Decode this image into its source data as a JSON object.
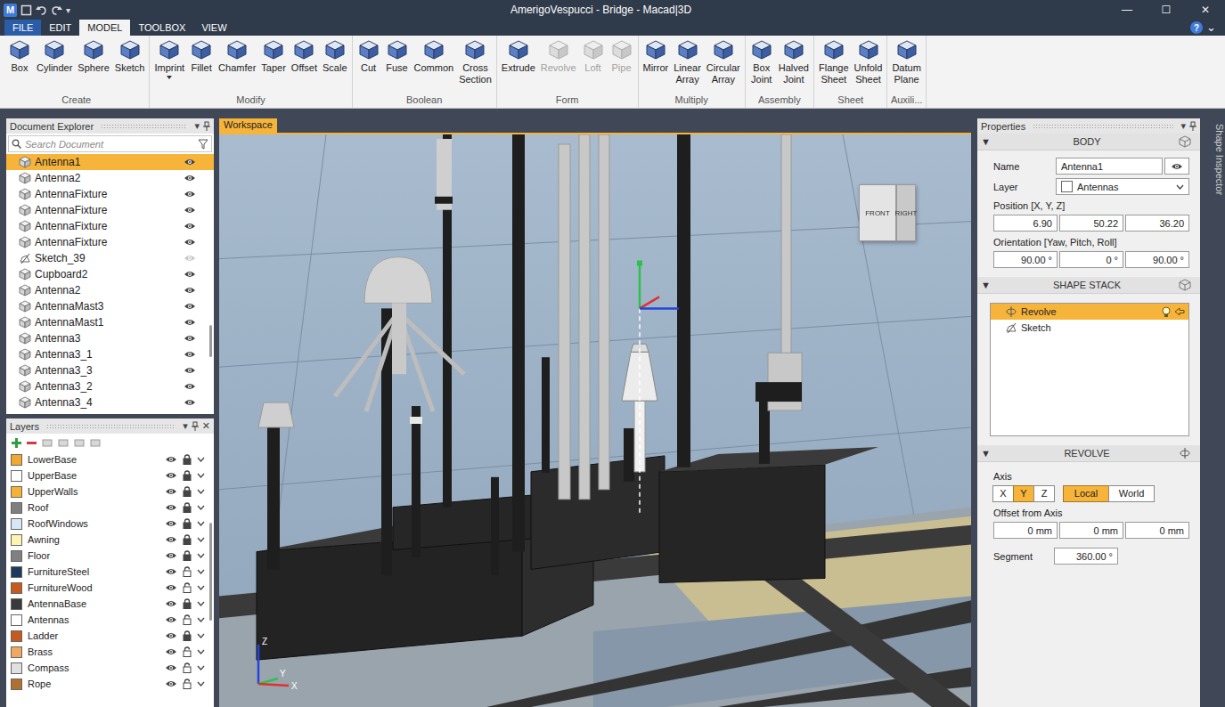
{
  "window": {
    "title": "AmerigoVespucci - Bridge - Macad|3D",
    "logo": "M",
    "quick_menu": "▾",
    "controls": [
      "—",
      "☐",
      "✕"
    ]
  },
  "menu": {
    "tabs": [
      {
        "label": "FILE",
        "kind": "file",
        "selected": false
      },
      {
        "label": "EDIT",
        "kind": "tab",
        "selected": false
      },
      {
        "label": "MODEL",
        "kind": "tab",
        "selected": true
      },
      {
        "label": "TOOLBOX",
        "kind": "tab",
        "selected": false
      },
      {
        "label": "VIEW",
        "kind": "tab",
        "selected": false
      }
    ],
    "help": "?",
    "collapse": "⌄"
  },
  "ribbon": {
    "groups": [
      {
        "label": "Create",
        "tools": [
          {
            "label": "Box",
            "disabled": false,
            "dropdown": false
          },
          {
            "label": "Cylinder",
            "disabled": false,
            "dropdown": false
          },
          {
            "label": "Sphere",
            "disabled": false,
            "dropdown": false
          },
          {
            "label": "Sketch",
            "disabled": false,
            "dropdown": false
          }
        ]
      },
      {
        "label": "Modify",
        "tools": [
          {
            "label": "Imprint",
            "disabled": false,
            "dropdown": true
          },
          {
            "label": "Fillet",
            "disabled": false,
            "dropdown": false
          },
          {
            "label": "Chamfer",
            "disabled": false,
            "dropdown": false
          },
          {
            "label": "Taper",
            "disabled": false,
            "dropdown": false
          },
          {
            "label": "Offset",
            "disabled": false,
            "dropdown": false
          },
          {
            "label": "Scale",
            "disabled": false,
            "dropdown": false
          }
        ]
      },
      {
        "label": "Boolean",
        "tools": [
          {
            "label": "Cut",
            "disabled": false,
            "dropdown": false
          },
          {
            "label": "Fuse",
            "disabled": false,
            "dropdown": false
          },
          {
            "label": "Common",
            "disabled": false,
            "dropdown": false
          },
          {
            "label": "Cross Section",
            "disabled": false,
            "dropdown": false
          }
        ]
      },
      {
        "label": "Form",
        "tools": [
          {
            "label": "Extrude",
            "disabled": false,
            "dropdown": false
          },
          {
            "label": "Revolve",
            "disabled": true,
            "dropdown": false
          },
          {
            "label": "Loft",
            "disabled": true,
            "dropdown": false
          },
          {
            "label": "Pipe",
            "disabled": true,
            "dropdown": false
          }
        ]
      },
      {
        "label": "Multiply",
        "tools": [
          {
            "label": "Mirror",
            "disabled": false,
            "dropdown": false
          },
          {
            "label": "Linear Array",
            "disabled": false,
            "dropdown": false
          },
          {
            "label": "Circular Array",
            "disabled": false,
            "dropdown": false
          }
        ]
      },
      {
        "label": "Assembly",
        "tools": [
          {
            "label": "Box Joint",
            "disabled": false,
            "dropdown": false
          },
          {
            "label": "Halved Joint",
            "disabled": false,
            "dropdown": false
          }
        ]
      },
      {
        "label": "Sheet",
        "tools": [
          {
            "label": "Flange Sheet",
            "disabled": false,
            "dropdown": false
          },
          {
            "label": "Unfold Sheet",
            "disabled": false,
            "dropdown": false
          }
        ]
      },
      {
        "label": "Auxili...",
        "tools": [
          {
            "label": "Datum Plane",
            "disabled": false,
            "dropdown": false
          }
        ]
      }
    ]
  },
  "explorer": {
    "title": "Document Explorer",
    "menu": "▾",
    "search_placeholder": "Search Document",
    "items": [
      {
        "name": "Antenna1",
        "kind": "body",
        "visible": true,
        "selected": true
      },
      {
        "name": "Antenna2",
        "kind": "body",
        "visible": true,
        "selected": false
      },
      {
        "name": "AntennaFixture",
        "kind": "body",
        "visible": true,
        "selected": false
      },
      {
        "name": "AntennaFixture",
        "kind": "body",
        "visible": true,
        "selected": false
      },
      {
        "name": "AntennaFixture",
        "kind": "body",
        "visible": true,
        "selected": false
      },
      {
        "name": "AntennaFixture",
        "kind": "body",
        "visible": true,
        "selected": false
      },
      {
        "name": "Sketch_39",
        "kind": "sketch",
        "visible": false,
        "selected": false
      },
      {
        "name": "Cupboard2",
        "kind": "body",
        "visible": true,
        "selected": false
      },
      {
        "name": "Antenna2",
        "kind": "body",
        "visible": true,
        "selected": false
      },
      {
        "name": "AntennaMast3",
        "kind": "body",
        "visible": true,
        "selected": false
      },
      {
        "name": "AntennaMast1",
        "kind": "body",
        "visible": true,
        "selected": false
      },
      {
        "name": "Antenna3",
        "kind": "body",
        "visible": true,
        "selected": false
      },
      {
        "name": "Antenna3_1",
        "kind": "body",
        "visible": true,
        "selected": false
      },
      {
        "name": "Antenna3_3",
        "kind": "body",
        "visible": true,
        "selected": false
      },
      {
        "name": "Antenna3_2",
        "kind": "body",
        "visible": true,
        "selected": false
      },
      {
        "name": "Antenna3_4",
        "kind": "body",
        "visible": true,
        "selected": false
      }
    ]
  },
  "layers": {
    "title": "Layers",
    "menu": "▾",
    "close": "✕",
    "items": [
      {
        "name": "LowerBase",
        "color": "#f0a830",
        "visible": true,
        "locked": true
      },
      {
        "name": "UpperBase",
        "color": "#ffffff",
        "visible": true,
        "locked": true
      },
      {
        "name": "UpperWalls",
        "color": "#f5b335",
        "visible": true,
        "locked": true
      },
      {
        "name": "Roof",
        "color": "#7f7f7f",
        "visible": true,
        "locked": true
      },
      {
        "name": "RoofWindows",
        "color": "#d6e8f5",
        "visible": true,
        "locked": true
      },
      {
        "name": "Awning",
        "color": "#fff3b0",
        "visible": true,
        "locked": true
      },
      {
        "name": "Floor",
        "color": "#808080",
        "visible": true,
        "locked": true
      },
      {
        "name": "FurnitureSteel",
        "color": "#1f3a5f",
        "visible": true,
        "locked": false
      },
      {
        "name": "FurnitureWood",
        "color": "#c65a1e",
        "visible": true,
        "locked": false
      },
      {
        "name": "AntennaBase",
        "color": "#3a3a3a",
        "visible": true,
        "locked": true
      },
      {
        "name": "Antennas",
        "color": "#ffffff",
        "visible": true,
        "locked": false
      },
      {
        "name": "Ladder",
        "color": "#c65a1e",
        "visible": true,
        "locked": true
      },
      {
        "name": "Brass",
        "color": "#f0a860",
        "visible": true,
        "locked": false
      },
      {
        "name": "Compass",
        "color": "#e0e0e0",
        "visible": true,
        "locked": false
      },
      {
        "name": "Rope",
        "color": "#b07030",
        "visible": true,
        "locked": false
      }
    ]
  },
  "workspace": {
    "tab": "Workspace",
    "viewcube": {
      "front": "FRONT",
      "right": "RIGHT"
    },
    "axes": {
      "z": "Z",
      "y": "Y",
      "x": "X"
    }
  },
  "properties": {
    "title": "Properties",
    "menu": "▾",
    "side_tab": "Shape Inspector",
    "body": {
      "title": "BODY",
      "collapse": "▼",
      "name_label": "Name",
      "name": "Antenna1",
      "layer_label": "Layer",
      "layer": "Antennas",
      "layer_color": "#ffffff",
      "position_label": "Position [X, Y, Z]",
      "position": [
        "6.90",
        "50.22",
        "36.20"
      ],
      "orientation_label": "Orientation [Yaw, Pitch, Roll]",
      "orientation": [
        "90.00 °",
        "0 °",
        "90.00 °"
      ]
    },
    "shape_stack": {
      "title": "SHAPE STACK",
      "collapse": "▼",
      "items": [
        {
          "name": "Revolve",
          "kind": "revolve",
          "selected": true
        },
        {
          "name": "Sketch",
          "kind": "sketch",
          "selected": false
        }
      ]
    },
    "revolve": {
      "title": "REVOLVE",
      "collapse": "▼",
      "axis_label": "Axis",
      "axes": [
        {
          "label": "X",
          "selected": false
        },
        {
          "label": "Y",
          "selected": true
        },
        {
          "label": "Z",
          "selected": false
        }
      ],
      "spaces": [
        {
          "label": "Local",
          "selected": true
        },
        {
          "label": "World",
          "selected": false
        }
      ],
      "offset_label": "Offset from Axis",
      "offsets": [
        "0 mm",
        "0 mm",
        "0 mm"
      ],
      "segment_label": "Segment",
      "segment": "360.00 °"
    }
  }
}
